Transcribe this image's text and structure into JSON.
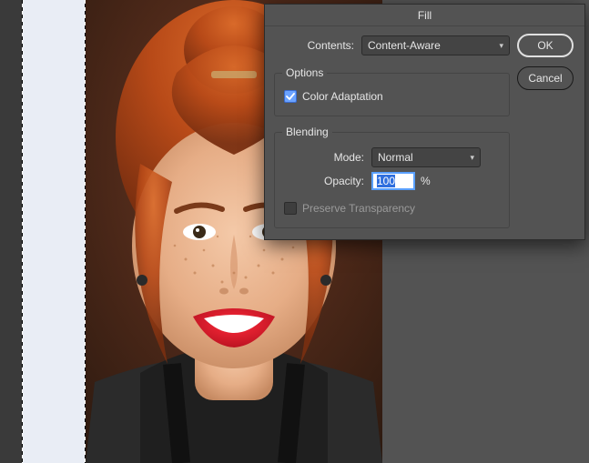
{
  "dialog": {
    "title": "Fill",
    "contents_label": "Contents:",
    "contents_value": "Content-Aware",
    "options_group_label": "Options",
    "color_adaptation_label": "Color Adaptation",
    "color_adaptation_checked": true,
    "blending_group_label": "Blending",
    "mode_label": "Mode:",
    "mode_value": "Normal",
    "opacity_label": "Opacity:",
    "opacity_value": "100",
    "opacity_unit": "%",
    "preserve_transparency_label": "Preserve Transparency",
    "preserve_transparency_checked": false,
    "ok_label": "OK",
    "cancel_label": "Cancel"
  }
}
